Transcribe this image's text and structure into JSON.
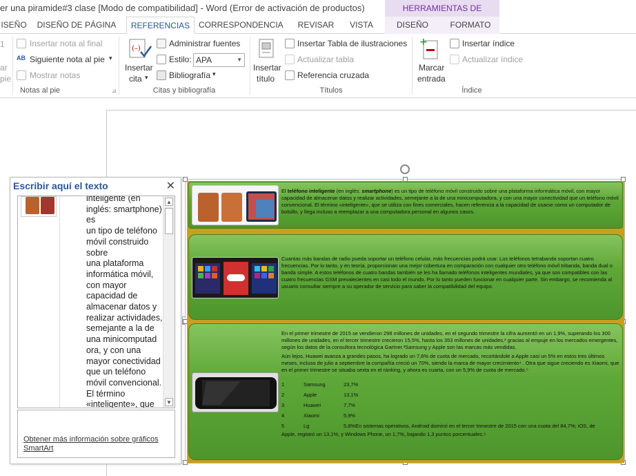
{
  "window": {
    "title": "er una piramide#3 clase [Modo de compatibilidad] - Word (Error de activación de productos)",
    "contextual_header": "HERRAMIENTAS DE SMARTART"
  },
  "tabs": [
    {
      "label": "ISEÑO"
    },
    {
      "label": "DISEÑO DE PÁGINA"
    },
    {
      "label": "REFERENCIAS"
    },
    {
      "label": "CORRESPONDENCIA"
    },
    {
      "label": "REVISAR"
    },
    {
      "label": "VISTA"
    },
    {
      "label": "DISEÑO"
    },
    {
      "label": "FORMATO"
    }
  ],
  "ribbon": {
    "partial_left": {
      "a": "ar",
      "b": "pie",
      "c": "1"
    },
    "notes": {
      "insert_endnote": "Insertar nota al final",
      "next_footnote": "Siguiente nota al pie",
      "show_notes": "Mostrar notas",
      "group_label": "Notas al pie"
    },
    "citations": {
      "insert_citation_1": "Insertar",
      "insert_citation_2": "cita",
      "manage_sources": "Administrar fuentes",
      "style_label": "Estilo:",
      "style_value": "APA",
      "bibliography": "Bibliografía",
      "group_label": "Citas y bibliografía"
    },
    "captions": {
      "insert_caption_1": "Insertar",
      "insert_caption_2": "título",
      "insert_table_of_figures": "Insertar Tabla de ilustraciones",
      "update_table": "Actualizar tabla",
      "cross_reference": "Referencia cruzada",
      "group_label": "Títulos"
    },
    "index": {
      "mark_entry_1": "Marcar",
      "mark_entry_2": "entrada",
      "insert_index": "Insertar índice",
      "update_index": "Actualizar índice",
      "group_label": "Índice"
    }
  },
  "text_pane": {
    "title": "Escribir aquí el texto",
    "content": "inteligente (en inglés: smartphone) es\nun tipo de teléfono\nmóvil construido\nsobre\nuna plataforma\ninformática móvil,\ncon mayor\ncapacidad de\nalmacenar datos y\nrealizar actividades,\nsemejante a la de\nuna minicomputad\nora, y con una\nmayor conectividad\nque un teléfono\nmóvil convencional.\nEl término\n«inteligente», que\nse utiliza con fines",
    "more_info_link": "Obtener más información sobre gráficos SmartArt"
  },
  "smartart": {
    "item1_text_a": "El ",
    "item1_text_bold": "teléfono inteligente",
    "item1_text_b": " (en inglés: ",
    "item1_text_italic": "smartphone",
    "item1_text_c": ") es un tipo de teléfono móvil construido sobre una plataforma informática móvil, con mayor capacidad de almacenar datos y realizar actividades, semejante a la de una minicomputadora, y con una mayor conectividad que un teléfono móvil convencional. El término «inteligente», que se utiliza con fines comerciales, hacen referencia a la capacidad de usarse como un computador de bolsillo, y llega incluso a reemplazar a una computadora personal en algunos casos.",
    "item2_text": "Cuantas más bandas de radio pueda soportar un teléfono celular, más frecuencias podrá usar. Los teléfonos tetrabanda soportan cuatro frecuencias. Por lo tanto, y en teoría, proporcionan una mejor cobertura en comparación con cualquier otro teléfono móvil tribanda, banda dual o banda simple. A estos teléfonos de cuatro bandas también se les ha llamado teléfonos inteligentes mundiales, ya que son compatibles con las cuatro frecuencias GSM prevalecientes en casi todo el mundo. Por lo tanto pueden funcionar en cualquier parte. Sin embargo, se recomienda al usuario consultar siempre a su operador de servicio para saber la compatibilidad del equipo.",
    "item3_para1": "En el primer trimestre de 2015 se vendieron 298 millones de unidades, en el segundo trimestre la cifra aumentó en un 1,9%, superando los 300 millones de unidades, en el tercer trimestre crecieron 15,5%, hasta los 353 millones de unidades,² gracias al empuje en los mercados emergentes, según los datos de la consultora tecnológica Gartner.³Samsung y Apple son las marcas más vendidas.",
    "item3_para2": "Aún lejos, Huawei avanza a grandes pasos, ha logrado un 7,6% de cuota de mercado, recortándole a Apple casi un 5% en estos tres últimos meses, incluso de julio a septiembre la compañía creció un 70%, siendo la marca de mayor crecimiento⁴ . Otra que sigue creciendo es Xiaomi, que en el primer trimestre se situaba sexta en el ránking, y ahora es cuarta, con un 5,9% de cuota de mercado.⁵",
    "market_table": [
      {
        "rank": "1",
        "brand": "Samsung",
        "share": "23,7%"
      },
      {
        "rank": "2",
        "brand": "Apple",
        "share": "13,1%"
      },
      {
        "rank": "3",
        "brand": "Huawei",
        "share": "7,7%"
      },
      {
        "rank": "4",
        "brand": "Xiaomi",
        "share": "5,9%"
      },
      {
        "rank": "5",
        "brand": "Lg",
        "share": "5,8%En sistemas operativos, Android dominó en el tercer trimestre de 2015 con una cuota del 84,7%; iOS, de"
      }
    ],
    "item3_tail": "Apple, registró un 13,1%, y Windows Phone, un 1,7%, bajando 1,3 puntos porcentuales.⁶"
  },
  "colors": {
    "accent_blue": "#2b579a",
    "smartart_purple": "#7030a0",
    "band_green": "#5ea838",
    "frame_gold": "#c8a020"
  }
}
